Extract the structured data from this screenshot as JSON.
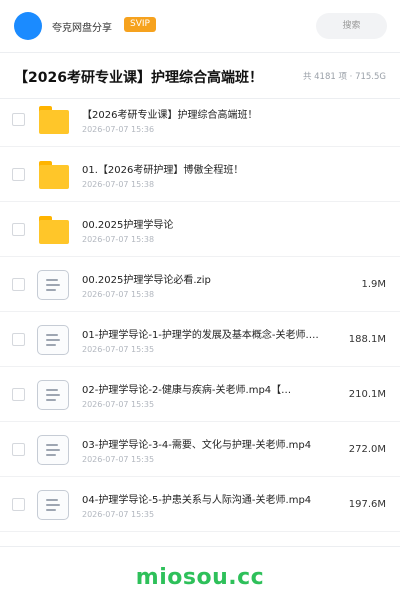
{
  "topbar": {
    "brand": "夸克网盘分享",
    "badge": "SVIP",
    "search_placeholder": "搜索"
  },
  "header": {
    "title": "【2026考研专业课】护理综合高端班！",
    "meta": "共 4181 项 · 715.5G"
  },
  "files": [
    {
      "type": "folder",
      "name": "【2026考研专业课】护理综合高端班！",
      "date": "2026-07-07 15:36",
      "size": ""
    },
    {
      "type": "folder",
      "name": "01.【2026考研护理】博傲全程班！",
      "date": "2026-07-07 15:38",
      "size": ""
    },
    {
      "type": "folder",
      "name": "00.2025护理学导论",
      "date": "2026-07-07 15:38",
      "size": ""
    },
    {
      "type": "file",
      "name": "00.2025护理学导论必看.zip",
      "date": "2026-07-07 15:38",
      "size": "1.9M"
    },
    {
      "type": "file",
      "name": "01-护理学导论-1-护理学的发展及基本概念-关老师.mp4",
      "date": "2026-07-07 15:35",
      "size": "188.1M"
    },
    {
      "type": "file",
      "name": "02-护理学导论-2-健康与疾病-关老师.mp4【…",
      "date": "2026-07-07 15:35",
      "size": "210.1M"
    },
    {
      "type": "file",
      "name": "03-护理学导论-3-4-需要、文化与护理-关老师.mp4",
      "date": "2026-07-07 15:35",
      "size": "272.0M"
    },
    {
      "type": "file",
      "name": "04-护理学导论-5-护患关系与人际沟通-关老师.mp4",
      "date": "2026-07-07 15:35",
      "size": "197.6M"
    }
  ],
  "footer": {
    "watermark": "miosou.cc"
  },
  "colors": {
    "accent": "#1b8bff",
    "badge": "#f6a21e",
    "folder": "#ffc629",
    "watermark": "#2ec05a"
  }
}
